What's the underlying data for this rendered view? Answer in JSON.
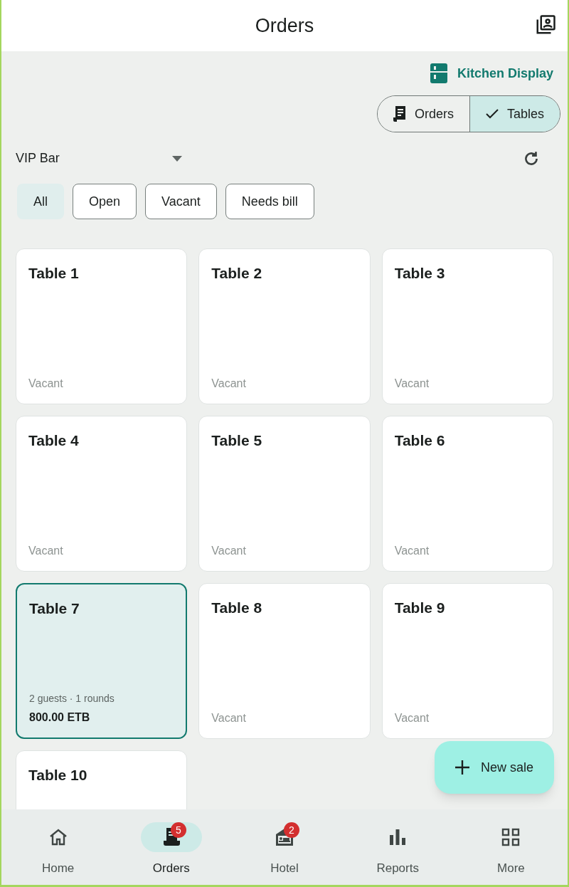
{
  "app_bar": {
    "title": "Orders"
  },
  "kitchen_display": {
    "label": "Kitchen Display"
  },
  "view_toggle": [
    {
      "label": "Orders",
      "selected": false
    },
    {
      "label": "Tables",
      "selected": true
    }
  ],
  "area_select": {
    "value": "VIP Bar"
  },
  "filters": [
    {
      "label": "All",
      "selected": true
    },
    {
      "label": "Open",
      "selected": false
    },
    {
      "label": "Vacant",
      "selected": false
    },
    {
      "label": "Needs bill",
      "selected": false
    }
  ],
  "tables": [
    {
      "name": "Table 1",
      "kind": "vacant",
      "status": "Vacant",
      "selected": false
    },
    {
      "name": "Table 2",
      "kind": "vacant",
      "status": "Vacant",
      "selected": false
    },
    {
      "name": "Table 3",
      "kind": "vacant",
      "status": "Vacant",
      "selected": false
    },
    {
      "name": "Table 4",
      "kind": "vacant",
      "status": "Vacant",
      "selected": false
    },
    {
      "name": "Table 5",
      "kind": "vacant",
      "status": "Vacant",
      "selected": false
    },
    {
      "name": "Table 6",
      "kind": "vacant",
      "status": "Vacant",
      "selected": false
    },
    {
      "name": "Table 7",
      "kind": "occupied",
      "guests": "2 guests · 1 rounds",
      "total": "800.00 ETB",
      "selected": true
    },
    {
      "name": "Table 8",
      "kind": "vacant",
      "status": "Vacant",
      "selected": false
    },
    {
      "name": "Table 9",
      "kind": "vacant",
      "status": "Vacant",
      "selected": false
    },
    {
      "name": "Table 10",
      "kind": "vacant",
      "selected": false
    }
  ],
  "fab": {
    "label": "New sale"
  },
  "bottom_nav": [
    {
      "kind": "home",
      "label": "Home",
      "selected": false
    },
    {
      "kind": "orders",
      "label": "Orders",
      "selected": true,
      "badge": "5"
    },
    {
      "kind": "hotel",
      "label": "Hotel",
      "selected": false,
      "badge": "2"
    },
    {
      "kind": "reports",
      "label": "Reports",
      "selected": false
    },
    {
      "kind": "more",
      "label": "More",
      "selected": false
    }
  ]
}
